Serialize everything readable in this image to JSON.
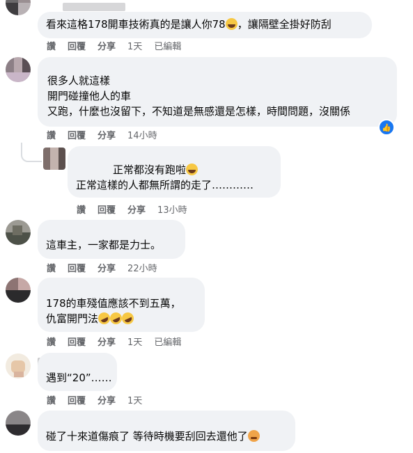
{
  "comments": [
    {
      "lines": [
        "看來這格178開車技術真的是讓人你78",
        "，讓隔壁全掛好防刮"
      ],
      "actions": {
        "like": "讚",
        "reply": "回覆",
        "share": "分享",
        "time": "1天",
        "edited": "已編輯"
      }
    },
    {
      "lines": [
        "很多人就這樣",
        "開門碰撞他人的車",
        "又跑，什麼也沒留下，不知道是無感還是怎樣，時間問題，沒關係"
      ],
      "actions": {
        "like": "讚",
        "reply": "回覆",
        "share": "分享",
        "time": "14小時"
      },
      "reaction": "like"
    },
    {
      "lines": [
        "正常都沒有跑啦",
        "正常這樣的人都無所謂的走了…………"
      ],
      "actions": {
        "like": "讚",
        "reply": "回覆",
        "share": "分享",
        "time": "13小時"
      }
    },
    {
      "lines": [
        "這車主，一家都是力士。"
      ],
      "actions": {
        "like": "讚",
        "reply": "回覆",
        "share": "分享",
        "time": "22小時"
      }
    },
    {
      "lines": [
        "178的車殘值應該不到五萬，",
        "仇富開門法"
      ],
      "actions": {
        "like": "讚",
        "reply": "回覆",
        "share": "分享",
        "time": "1天",
        "edited": "已編輯"
      }
    },
    {
      "lines": [
        "遇到“20”……"
      ],
      "actions": {
        "like": "讚",
        "reply": "回覆",
        "share": "分享",
        "time": "1天"
      }
    },
    {
      "lines": [
        "碰了十來道傷痕了 等待時機要刮回去還他了"
      ]
    }
  ]
}
